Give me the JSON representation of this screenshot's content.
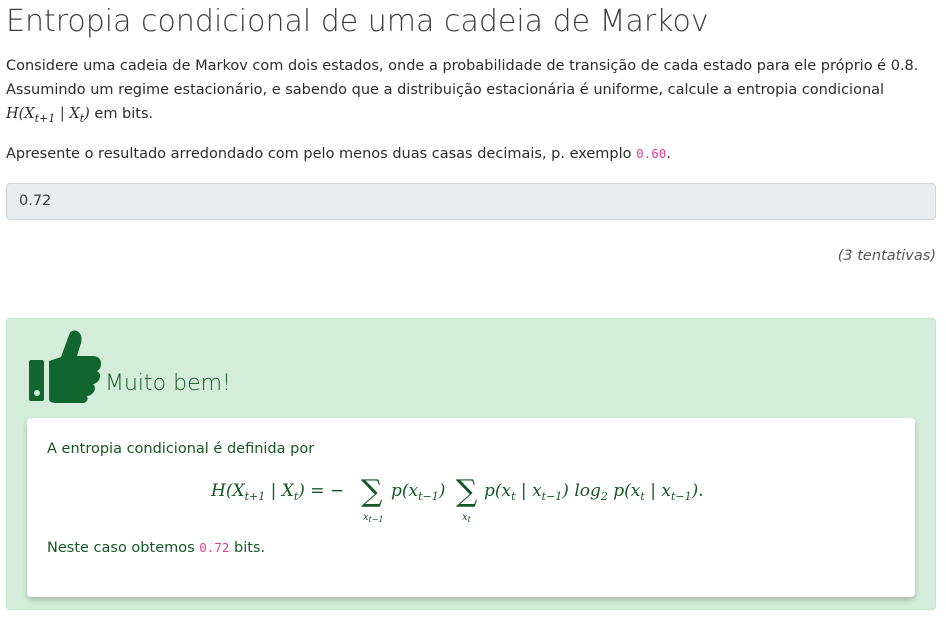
{
  "page": {
    "title": "Entropia condicional de uma cadeia de Markov"
  },
  "question": {
    "intro": "Considere uma cadeia de Markov com dois estados, onde a probabilidade de transição de cada estado para ele próprio é 0.8. Assumindo um regime estacionário, e sabendo que a distribuição estacionária é uniforme, calcule a entropia condicional",
    "expr_H": "H(X",
    "expr_sub1": "t+1",
    "expr_mid": " | X",
    "expr_sub2": "t",
    "expr_close": ")",
    "intro_suffix": " em bits.",
    "instruction": "Apresente o resultado arredondado com pelo menos duas casas decimais, p. exemplo ",
    "example_code": "0.60",
    "instruction_end": "."
  },
  "answer": {
    "value": "0.72"
  },
  "attempts_label": "(3 tentativas)",
  "feedback": {
    "icon": "thumbs-up-icon",
    "title": "Muito bem!",
    "definition_text": "A entropia condicional é definida por",
    "formula": {
      "lhs": "H(X",
      "lhs_sub1": "t+1",
      "lhs_bar": " | X",
      "lhs_sub2": "t",
      "lhs_end": ") = −",
      "sum1_sub": "x",
      "sum1_sub_idx": "t−1",
      "term1": "p(x",
      "term1_sub": "t−1",
      "term1_end": ")",
      "sum2_sub": "x",
      "sum2_sub_idx": "t",
      "term2": "p(x",
      "term2_sub_a": "t",
      "term2_bar": " | x",
      "term2_sub_b": "t−1",
      "term2_end": ") log",
      "log_base": "2",
      "term3": " p(x",
      "term3_sub_a": "t",
      "term3_bar": " | x",
      "term3_sub_b": "t−1",
      "term3_end": ")."
    },
    "result_prefix": "Neste caso obtemos ",
    "result_code": "0.72",
    "result_suffix": " bits."
  },
  "colors": {
    "success_bg": "#d4edda",
    "success_text": "#155724",
    "icon_green": "#11662f",
    "code_pink": "#e83e8c"
  }
}
